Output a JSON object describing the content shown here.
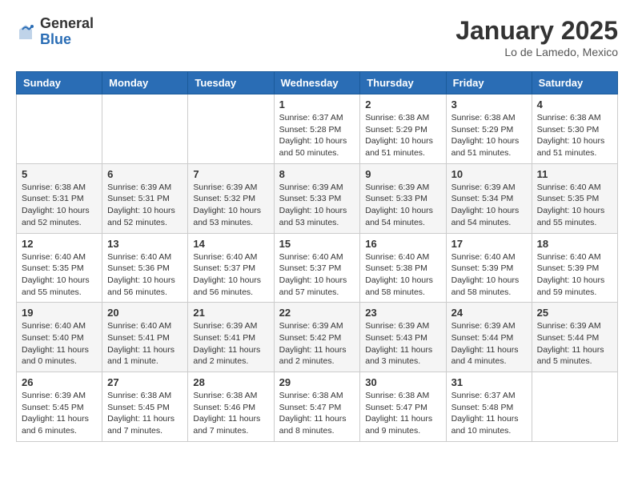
{
  "header": {
    "logo_general": "General",
    "logo_blue": "Blue",
    "month_title": "January 2025",
    "location": "Lo de Lamedo, Mexico"
  },
  "weekdays": [
    "Sunday",
    "Monday",
    "Tuesday",
    "Wednesday",
    "Thursday",
    "Friday",
    "Saturday"
  ],
  "weeks": [
    [
      {
        "day": "",
        "info": ""
      },
      {
        "day": "",
        "info": ""
      },
      {
        "day": "",
        "info": ""
      },
      {
        "day": "1",
        "info": "Sunrise: 6:37 AM\nSunset: 5:28 PM\nDaylight: 10 hours\nand 50 minutes."
      },
      {
        "day": "2",
        "info": "Sunrise: 6:38 AM\nSunset: 5:29 PM\nDaylight: 10 hours\nand 51 minutes."
      },
      {
        "day": "3",
        "info": "Sunrise: 6:38 AM\nSunset: 5:29 PM\nDaylight: 10 hours\nand 51 minutes."
      },
      {
        "day": "4",
        "info": "Sunrise: 6:38 AM\nSunset: 5:30 PM\nDaylight: 10 hours\nand 51 minutes."
      }
    ],
    [
      {
        "day": "5",
        "info": "Sunrise: 6:38 AM\nSunset: 5:31 PM\nDaylight: 10 hours\nand 52 minutes."
      },
      {
        "day": "6",
        "info": "Sunrise: 6:39 AM\nSunset: 5:31 PM\nDaylight: 10 hours\nand 52 minutes."
      },
      {
        "day": "7",
        "info": "Sunrise: 6:39 AM\nSunset: 5:32 PM\nDaylight: 10 hours\nand 53 minutes."
      },
      {
        "day": "8",
        "info": "Sunrise: 6:39 AM\nSunset: 5:33 PM\nDaylight: 10 hours\nand 53 minutes."
      },
      {
        "day": "9",
        "info": "Sunrise: 6:39 AM\nSunset: 5:33 PM\nDaylight: 10 hours\nand 54 minutes."
      },
      {
        "day": "10",
        "info": "Sunrise: 6:39 AM\nSunset: 5:34 PM\nDaylight: 10 hours\nand 54 minutes."
      },
      {
        "day": "11",
        "info": "Sunrise: 6:40 AM\nSunset: 5:35 PM\nDaylight: 10 hours\nand 55 minutes."
      }
    ],
    [
      {
        "day": "12",
        "info": "Sunrise: 6:40 AM\nSunset: 5:35 PM\nDaylight: 10 hours\nand 55 minutes."
      },
      {
        "day": "13",
        "info": "Sunrise: 6:40 AM\nSunset: 5:36 PM\nDaylight: 10 hours\nand 56 minutes."
      },
      {
        "day": "14",
        "info": "Sunrise: 6:40 AM\nSunset: 5:37 PM\nDaylight: 10 hours\nand 56 minutes."
      },
      {
        "day": "15",
        "info": "Sunrise: 6:40 AM\nSunset: 5:37 PM\nDaylight: 10 hours\nand 57 minutes."
      },
      {
        "day": "16",
        "info": "Sunrise: 6:40 AM\nSunset: 5:38 PM\nDaylight: 10 hours\nand 58 minutes."
      },
      {
        "day": "17",
        "info": "Sunrise: 6:40 AM\nSunset: 5:39 PM\nDaylight: 10 hours\nand 58 minutes."
      },
      {
        "day": "18",
        "info": "Sunrise: 6:40 AM\nSunset: 5:39 PM\nDaylight: 10 hours\nand 59 minutes."
      }
    ],
    [
      {
        "day": "19",
        "info": "Sunrise: 6:40 AM\nSunset: 5:40 PM\nDaylight: 11 hours\nand 0 minutes."
      },
      {
        "day": "20",
        "info": "Sunrise: 6:40 AM\nSunset: 5:41 PM\nDaylight: 11 hours\nand 1 minute."
      },
      {
        "day": "21",
        "info": "Sunrise: 6:39 AM\nSunset: 5:41 PM\nDaylight: 11 hours\nand 2 minutes."
      },
      {
        "day": "22",
        "info": "Sunrise: 6:39 AM\nSunset: 5:42 PM\nDaylight: 11 hours\nand 2 minutes."
      },
      {
        "day": "23",
        "info": "Sunrise: 6:39 AM\nSunset: 5:43 PM\nDaylight: 11 hours\nand 3 minutes."
      },
      {
        "day": "24",
        "info": "Sunrise: 6:39 AM\nSunset: 5:44 PM\nDaylight: 11 hours\nand 4 minutes."
      },
      {
        "day": "25",
        "info": "Sunrise: 6:39 AM\nSunset: 5:44 PM\nDaylight: 11 hours\nand 5 minutes."
      }
    ],
    [
      {
        "day": "26",
        "info": "Sunrise: 6:39 AM\nSunset: 5:45 PM\nDaylight: 11 hours\nand 6 minutes."
      },
      {
        "day": "27",
        "info": "Sunrise: 6:38 AM\nSunset: 5:45 PM\nDaylight: 11 hours\nand 7 minutes."
      },
      {
        "day": "28",
        "info": "Sunrise: 6:38 AM\nSunset: 5:46 PM\nDaylight: 11 hours\nand 7 minutes."
      },
      {
        "day": "29",
        "info": "Sunrise: 6:38 AM\nSunset: 5:47 PM\nDaylight: 11 hours\nand 8 minutes."
      },
      {
        "day": "30",
        "info": "Sunrise: 6:38 AM\nSunset: 5:47 PM\nDaylight: 11 hours\nand 9 minutes."
      },
      {
        "day": "31",
        "info": "Sunrise: 6:37 AM\nSunset: 5:48 PM\nDaylight: 11 hours\nand 10 minutes."
      },
      {
        "day": "",
        "info": ""
      }
    ]
  ]
}
